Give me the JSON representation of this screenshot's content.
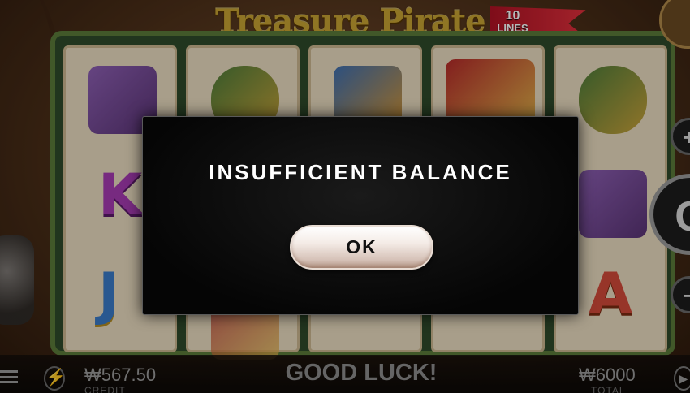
{
  "game": {
    "title": "Treasure Pirate",
    "lines_count": "10",
    "lines_label": "LINES"
  },
  "reels": {
    "visible_letters": [
      "K",
      "J",
      "A"
    ]
  },
  "bottom_bar": {
    "credit_value": "₩567.50",
    "credit_label": "CREDIT",
    "status_message": "GOOD LUCK!",
    "total_value": "₩6000",
    "total_label": "TOTAL"
  },
  "controls": {
    "plus_symbol": "+",
    "minus_symbol": "−",
    "spin_symbol": "C"
  },
  "dialog": {
    "message": "INSUFFICIENT BALANCE",
    "ok_label": "OK"
  },
  "icons": [
    "menu-icon",
    "turbo-icon",
    "autoplay-icon"
  ],
  "colors": {
    "dialog_bg": "#0a0a0a",
    "dialog_text": "#ffffff",
    "ok_button": "#f4ebe6",
    "logo_gold": "#c7a233",
    "banner_red": "#b01224"
  }
}
